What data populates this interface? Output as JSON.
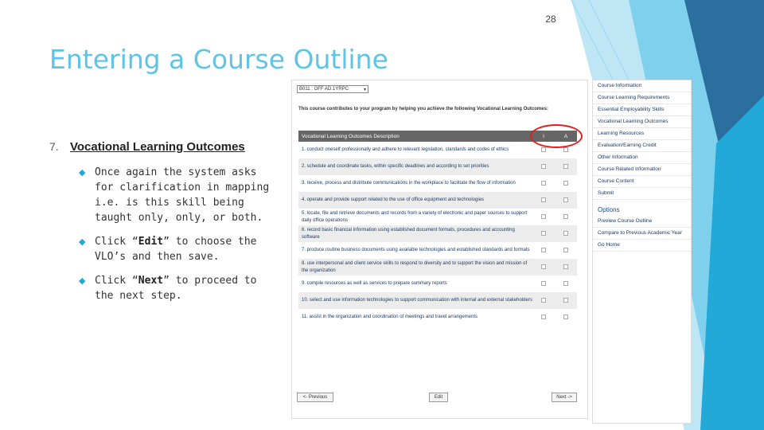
{
  "slide": {
    "number": "28",
    "title": "Entering a Course Outline",
    "heading_num": "7.",
    "heading": "Vocational Learning Outcomes",
    "bullets": [
      {
        "pre": "Once again the system asks for clarification in mapping i.e. is this skill being taught only, only, or both.",
        "bold": "",
        "post": ""
      },
      {
        "pre": "Click “",
        "bold": "Edit",
        "post": "” to choose the VLO’s and then save."
      },
      {
        "pre": "Click “",
        "bold": "Next",
        "post": "” to proceed to the next step."
      }
    ]
  },
  "app": {
    "program_select": "B011 : OFF AD.1YRPC",
    "intro": "This course contributes to your program by helping you achieve the following Vocational Learning Outcomes:",
    "table_header": {
      "desc": "Vocational Learning Outcomes Description",
      "col_i": "I",
      "col_a": "A"
    },
    "rows": [
      "1. conduct oneself professionally and adhere to relevant legislation, standards and codes of ethics",
      "2. schedule and coordinate tasks, within specific deadlines and according to set priorities",
      "3. receive, process and distribute communications in the workplace to facilitate the flow of information",
      "4. operate and provide support related to the use of office equipment and technologies",
      "5. locate, file and retrieve documents and records from a variety of electronic and paper sources to support daily office operations",
      "6. record basic financial information using established document formats, procedures and accounting software",
      "7. produce routine business documents using available technologies and established standards and formats",
      "8. use interpersonal and client service skills to respond to diversity and to support the vision and mission of the organization",
      "9. compile resources as well as services to prepare summary reports",
      "10. select and use information technologies to support communication with internal and external stakeholders",
      "11. assist in the organization and coordination of meetings and travel arrangements"
    ],
    "buttons": {
      "previous": "<- Previous",
      "edit": "Edit",
      "next": "Next ->"
    }
  },
  "sidebar": {
    "items": [
      "Course Information",
      "Course Learning Requirements",
      "Essential Employability Skills",
      "Vocational Learning Outcomes",
      "Learning Resources",
      "Evaluation/Earning Credit",
      "Other Information",
      "Course Related Information",
      "Course Content",
      "Submit"
    ],
    "options_heading": "Options",
    "options": [
      "Preview Course Outline",
      "Compare to Previous Academic Year",
      "Go Home"
    ]
  },
  "colors": {
    "title": "#5ec4e6",
    "accent": "#23a9d8",
    "circle": "#e02020"
  }
}
